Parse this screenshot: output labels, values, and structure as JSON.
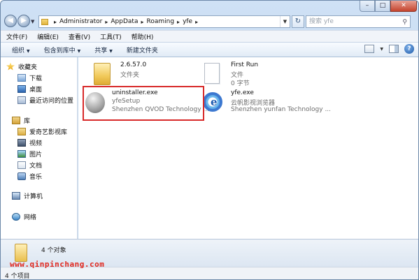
{
  "address": {
    "crumbs": [
      "Administrator",
      "AppData",
      "Roaming",
      "yfe"
    ],
    "search_placeholder": "搜索 yfe"
  },
  "menu": [
    "文件(F)",
    "编辑(E)",
    "查看(V)",
    "工具(T)",
    "帮助(H)"
  ],
  "toolbar": {
    "organize": "组织",
    "include_library": "包含到库中",
    "share": "共享",
    "new_folder": "新建文件夹"
  },
  "sidebar": {
    "favorites": "收藏夹",
    "downloads": "下载",
    "desktop": "桌面",
    "recent": "最近访问的位置",
    "library": "库",
    "iqiyi": "爱奇艺影视库",
    "videos": "视频",
    "pictures": "图片",
    "documents": "文档",
    "music": "音乐",
    "computer": "计算机",
    "network": "网络"
  },
  "files": [
    {
      "name": "2.6.57.0",
      "line2": "文件夹",
      "line3": ""
    },
    {
      "name": "First Run",
      "line2": "文件",
      "line3": "0 字节"
    },
    {
      "name": "uninstaller.exe",
      "line2": "yfeSetup",
      "line3": "Shenzhen QVOD Technology ..."
    },
    {
      "name": "yfe.exe",
      "line2": "云帆影视浏览器",
      "line3": "Shenzhen yunfan Technology ..."
    }
  ],
  "details": {
    "count": "4 个对象"
  },
  "status": {
    "count": "4 个项目"
  },
  "watermark": "www.qinpinchang.com"
}
